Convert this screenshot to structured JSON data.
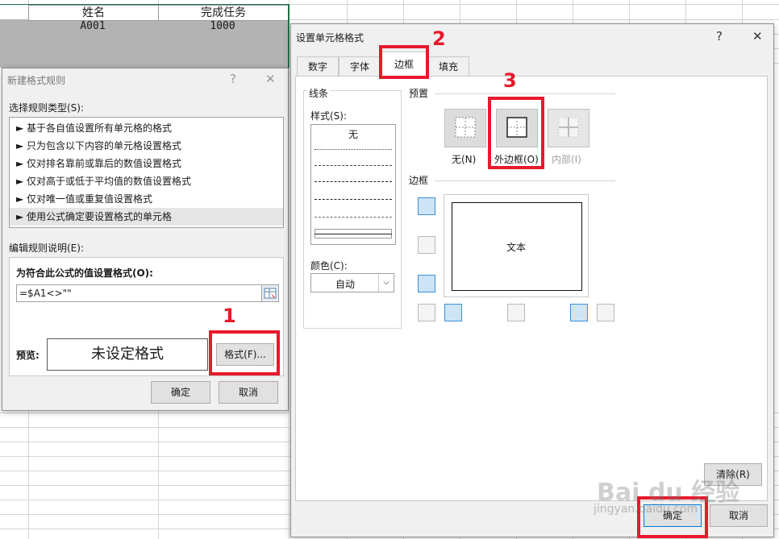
{
  "sheet": {
    "headers": [
      "姓名",
      "完成任务"
    ],
    "row1": [
      "A001",
      "1000"
    ]
  },
  "rule_dialog": {
    "title": "新建格式规则",
    "help": "?",
    "close": "✕",
    "select_type_label": "选择规则类型(S):",
    "rule_types": [
      "► 基于各自值设置所有单元格的格式",
      "► 只为包含以下内容的单元格设置格式",
      "► 仅对排名靠前或靠后的数值设置格式",
      "► 仅对高于或低于平均值的数值设置格式",
      "► 仅对唯一值或重复值设置格式",
      "► 使用公式确定要设置格式的单元格"
    ],
    "edit_desc_label": "编辑规则说明(E):",
    "formula_label": "为符合此公式的值设置格式(O):",
    "formula_value": "=$A1<>\"\"",
    "preview_label": "预览:",
    "preview_text": "未设定格式",
    "format_button": "格式(F)...",
    "ok": "确定",
    "cancel": "取消"
  },
  "cell_dialog": {
    "title": "设置单元格格式",
    "help": "?",
    "close": "✕",
    "tabs": [
      "数字",
      "字体",
      "边框",
      "填充"
    ],
    "line_group": "线条",
    "style_label": "样式(S):",
    "style_none": "无",
    "color_label": "颜色(C):",
    "color_value": "自动",
    "preset_group": "预置",
    "presets": [
      "无(N)",
      "外边框(O)",
      "内部(I)"
    ],
    "border_group": "边框",
    "preview_text": "文本",
    "clear_button": "清除(R)",
    "ok": "确定",
    "cancel": "取消"
  },
  "annotations": [
    "1",
    "2",
    "3"
  ],
  "watermark": {
    "brand": "Bai du 经验",
    "url": "jingyan.baidu.com"
  },
  "colors": {
    "annotation_red": "#e8192c",
    "active_blue": "#3b8fd6"
  }
}
